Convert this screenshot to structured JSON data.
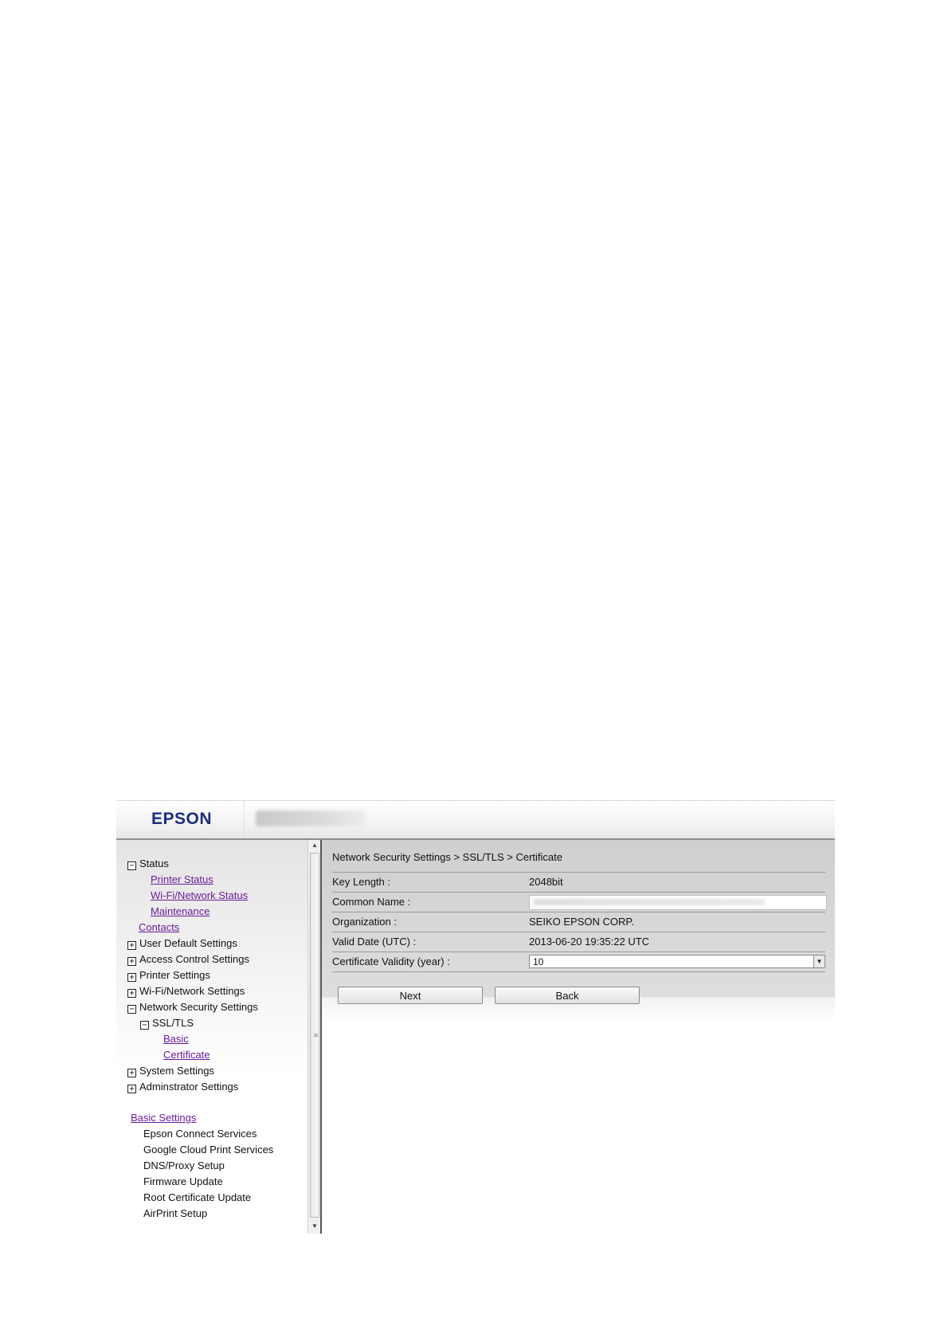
{
  "header": {
    "logo": "EPSON"
  },
  "sidebar": {
    "status": "Status",
    "printer_status": "Printer Status",
    "wifi_network_status": "Wi-Fi/Network Status",
    "maintenance": "Maintenance",
    "contacts": "Contacts",
    "user_default_settings": "User Default Settings",
    "access_control_settings": "Access Control Settings",
    "printer_settings": "Printer Settings",
    "wifi_network_settings": "Wi-Fi/Network Settings",
    "network_security_settings": "Network Security Settings",
    "ssl_tls": "SSL/TLS",
    "basic": "Basic",
    "certificate": "Certificate",
    "system_settings": "System Settings",
    "administrator_settings": "Adminstrator Settings",
    "basic_settings": "Basic Settings",
    "epson_connect_services": "Epson Connect Services",
    "google_cloud_print_services": "Google Cloud Print Services",
    "dns_proxy_setup": "DNS/Proxy Setup",
    "firmware_update": "Firmware Update",
    "root_certificate_update": "Root Certificate Update",
    "airprint_setup": "AirPrint Setup",
    "expand_symbol": "+",
    "collapse_symbol": "−"
  },
  "main": {
    "breadcrumb": "Network Security Settings > SSL/TLS > Certificate",
    "key_length_label": "Key Length :",
    "key_length_value": "2048bit",
    "common_name_label": "Common Name :",
    "organization_label": "Organization :",
    "organization_value": "SEIKO EPSON CORP.",
    "valid_date_label": "Valid Date (UTC) :",
    "valid_date_value": "2013-06-20 19:35:22 UTC",
    "validity_label": "Certificate Validity (year) :",
    "validity_value": "10",
    "next_button": "Next",
    "back_button": "Back"
  },
  "icons": {
    "scroll_up": "scroll-up-arrow-icon",
    "scroll_down": "scroll-down-arrow-icon",
    "select_arrow": "chevron-down-icon"
  }
}
